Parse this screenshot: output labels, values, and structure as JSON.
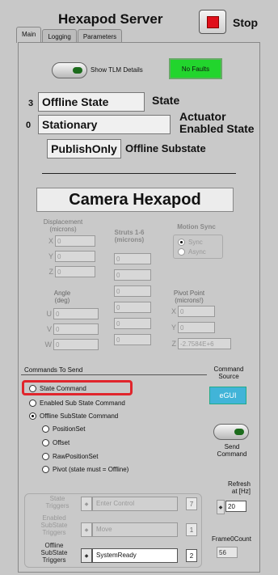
{
  "window": {
    "title": "Hexapod Server",
    "stop_label": "Stop"
  },
  "tabs": [
    {
      "label": "Main"
    },
    {
      "label": "Logging"
    },
    {
      "label": "Parameters"
    }
  ],
  "tlm": {
    "label": "Show TLM Details"
  },
  "faults": {
    "label": "No Faults",
    "color": "#22d52d"
  },
  "state": {
    "num": "3",
    "value": "Offline State",
    "label": "State"
  },
  "actuator": {
    "num": "0",
    "value": "Stationary",
    "label_line1": "Actuator",
    "label_line2": "Enabled State"
  },
  "substate": {
    "value": "PublishOnly",
    "label": "Offline Substate"
  },
  "camera": {
    "label": "Camera Hexapod"
  },
  "displacement": {
    "label_line1": "Displacement",
    "label_line2": "(microns)",
    "axes": [
      {
        "axis": "X",
        "value": "0"
      },
      {
        "axis": "Y",
        "value": "0"
      },
      {
        "axis": "Z",
        "value": "0"
      }
    ]
  },
  "struts": {
    "label_line1": "Struts 1-6",
    "label_line2": "(microns)",
    "values": [
      "0",
      "0",
      "0",
      "0",
      "0",
      "0"
    ]
  },
  "motion_sync": {
    "label": "Motion Sync",
    "options": [
      "Sync",
      "Async"
    ],
    "selected": "Sync"
  },
  "angle": {
    "label_line1": "Angle",
    "label_line2": "(deg)",
    "axes": [
      {
        "axis": "U",
        "value": "0"
      },
      {
        "axis": "V",
        "value": "0"
      },
      {
        "axis": "W",
        "value": "0"
      }
    ]
  },
  "pivot": {
    "label_line1": "Pivot Point",
    "label_line2": "(microns!)",
    "axes": [
      {
        "axis": "X",
        "value": "0"
      },
      {
        "axis": "Y",
        "value": "0"
      },
      {
        "axis": "Z",
        "value": "-2.7584E+6"
      }
    ]
  },
  "commands": {
    "title": "Commands To Send",
    "options": [
      {
        "label": "State Command",
        "selected": false
      },
      {
        "label": "Enabled Sub State Command",
        "selected": false
      },
      {
        "label": "Offline SubState Command",
        "selected": true
      }
    ],
    "sub_options": [
      {
        "label": "PositionSet",
        "selected": false
      },
      {
        "label": "Offset",
        "selected": false
      },
      {
        "label": "RawPositionSet",
        "selected": false
      },
      {
        "label": "Pivot (state must = Offline)",
        "selected": false
      }
    ]
  },
  "command_source": {
    "label_line1": "Command",
    "label_line2": "Source",
    "value": "eGUI",
    "color": "#41b4d8"
  },
  "send_command": {
    "label_line1": "Send",
    "label_line2": "Command"
  },
  "triggers": [
    {
      "label_line1": "State",
      "label_line2": "Triggers",
      "label_line3": "",
      "value": "Enter Control",
      "index": "7",
      "active": false
    },
    {
      "label_line1": "Enabled",
      "label_line2": "SubState",
      "label_line3": "Triggers",
      "value": "Move",
      "index": "1",
      "active": false
    },
    {
      "label_line1": "Offline",
      "label_line2": "SubState",
      "label_line3": "Triggers",
      "value": "SystemReady",
      "index": "2",
      "active": true
    }
  ],
  "refresh": {
    "label_line1": "Refresh",
    "label_line2": "at [Hz]",
    "value": "20"
  },
  "frame_count": {
    "label": "Frame0Count",
    "value": "56"
  }
}
